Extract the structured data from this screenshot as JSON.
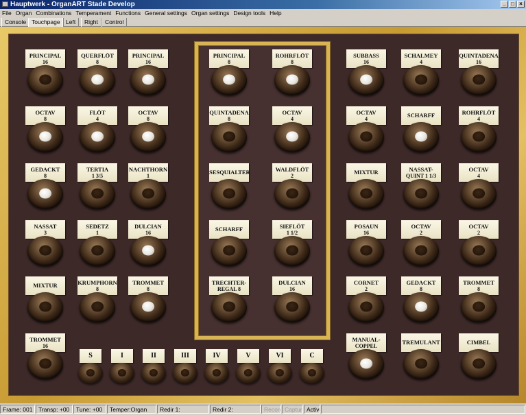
{
  "window": {
    "title": "Hauptwerk - OrganART Stade Develop",
    "min": "_",
    "max": "□",
    "close": "×"
  },
  "menu": [
    "File",
    "Organ",
    "Combinations",
    "Temperament",
    "Functions",
    "General settings",
    "Organ settings",
    "Design tools",
    "Help"
  ],
  "tabs": [
    {
      "label": "Console",
      "active": false
    },
    {
      "label": "Touchpage",
      "active": true
    },
    {
      "label": "Left",
      "active": false
    },
    {
      "label": "Right",
      "active": false
    },
    {
      "label": "Control",
      "active": false
    }
  ],
  "stops": [
    {
      "name": "PRINCIPAL",
      "sub": "16",
      "on": false
    },
    {
      "name": "QUERFLÖT",
      "sub": "8",
      "on": true
    },
    {
      "name": "PRINCIPAL",
      "sub": "16",
      "on": true
    },
    {
      "name": "OCTAV",
      "sub": "8",
      "on": true
    },
    {
      "name": "FLÖT",
      "sub": "4",
      "on": true
    },
    {
      "name": "OCTAV",
      "sub": "8",
      "on": true
    },
    {
      "name": "GEDACKT",
      "sub": "8",
      "on": true
    },
    {
      "name": "TERTIA",
      "sub": "1 3/5",
      "on": false
    },
    {
      "name": "NACHTHORN",
      "sub": "1",
      "on": false
    },
    {
      "name": "NASSAT",
      "sub": "3",
      "on": false
    },
    {
      "name": "SEDETZ",
      "sub": "1",
      "on": false
    },
    {
      "name": "DULCIAN",
      "sub": "16",
      "on": true
    },
    {
      "name": "MIXTUR",
      "sub": "",
      "on": false
    },
    {
      "name": "KRUMPHORN",
      "sub": "8",
      "on": false
    },
    {
      "name": "TROMMET",
      "sub": "8",
      "on": true
    },
    {
      "name": "TROMMET",
      "sub": "16",
      "on": false
    },
    {
      "name": "PRINCIPAL",
      "sub": "8",
      "on": true
    },
    {
      "name": "ROHRFLÖT",
      "sub": "8",
      "on": true
    },
    {
      "name": "QUINTADENA",
      "sub": "8",
      "on": false
    },
    {
      "name": "OCTAV",
      "sub": "4",
      "on": true
    },
    {
      "name": "SESQUIALTER",
      "sub": "",
      "on": false
    },
    {
      "name": "WALDFLÖT",
      "sub": "2",
      "on": false
    },
    {
      "name": "SCHARFF",
      "sub": "",
      "on": false
    },
    {
      "name": "SIEFLÖT",
      "sub": "1 1/2",
      "on": false
    },
    {
      "name": "TRECHTER-",
      "sub": "REGAL 8",
      "on": false
    },
    {
      "name": "DULCIAN",
      "sub": "16",
      "on": false
    },
    {
      "name": "SUBBASS",
      "sub": "16",
      "on": true
    },
    {
      "name": "SCHALMEY",
      "sub": "4",
      "on": false
    },
    {
      "name": "QUINTADENA",
      "sub": "16",
      "on": false
    },
    {
      "name": "OCTAV",
      "sub": "4",
      "on": false
    },
    {
      "name": "SCHARFF",
      "sub": "",
      "on": true
    },
    {
      "name": "ROHRFLÖT",
      "sub": "4",
      "on": false
    },
    {
      "name": "MIXTUR",
      "sub": "",
      "on": false
    },
    {
      "name": "NASSAT-",
      "sub": "QUINT 1 1/3",
      "on": false
    },
    {
      "name": "OCTAV",
      "sub": "4",
      "on": false
    },
    {
      "name": "POSAUN",
      "sub": "16",
      "on": false
    },
    {
      "name": "OCTAV",
      "sub": "2",
      "on": false
    },
    {
      "name": "OCTAV",
      "sub": "2",
      "on": false
    },
    {
      "name": "CORNET",
      "sub": "2",
      "on": false
    },
    {
      "name": "GEDACKT",
      "sub": "8",
      "on": true
    },
    {
      "name": "TROMMET",
      "sub": "8",
      "on": false
    },
    {
      "name": "MANUAL-",
      "sub": "COPPEL",
      "on": true
    },
    {
      "name": "TREMULANT",
      "sub": "",
      "on": false
    },
    {
      "name": "CIMBEL",
      "sub": "",
      "on": false
    }
  ],
  "combinations": [
    {
      "label": "S",
      "on": false
    },
    {
      "label": "I",
      "on": false
    },
    {
      "label": "II",
      "on": false
    },
    {
      "label": "III",
      "on": false
    },
    {
      "label": "IV",
      "on": false
    },
    {
      "label": "V",
      "on": false
    },
    {
      "label": "VI",
      "on": false
    },
    {
      "label": "C",
      "on": false
    }
  ],
  "status": {
    "frame": "Frame: 001",
    "transp": "Transp: +00",
    "tune": "Tune: +00",
    "temper": "Temper:Organ",
    "redir1": "Redir 1:",
    "redir2": "Redir 2:",
    "record": "Record",
    "capture": "Capture",
    "active": "Active"
  }
}
